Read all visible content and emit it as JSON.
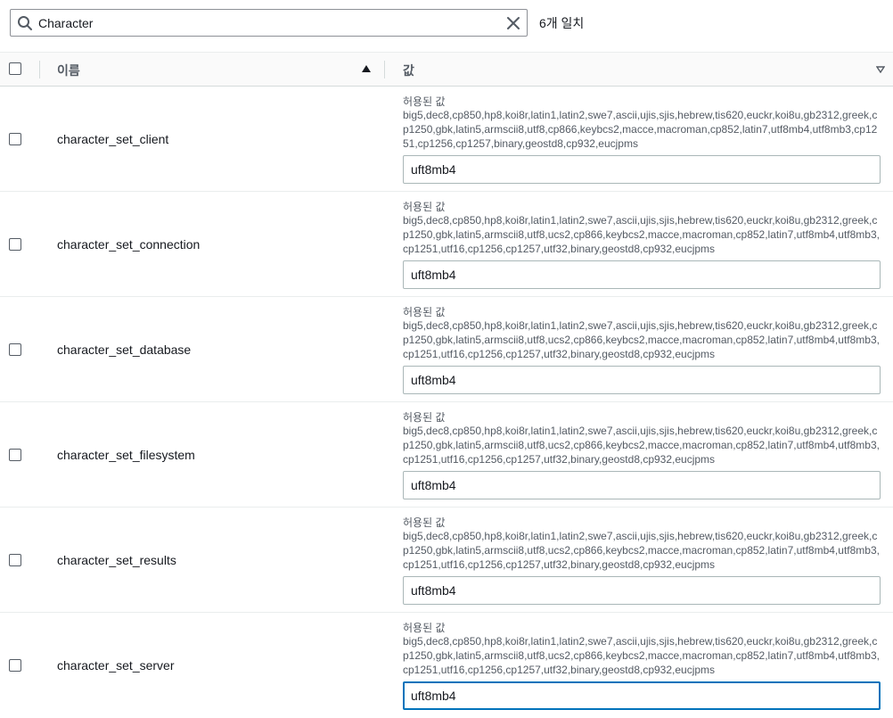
{
  "search": {
    "value": "Character",
    "match_count": "6개 일치"
  },
  "table": {
    "headers": {
      "name": "이름",
      "value": "값"
    },
    "allowed_label": "허용된 값",
    "rows": [
      {
        "name": "character_set_client",
        "allowed": "big5,dec8,cp850,hp8,koi8r,latin1,latin2,swe7,ascii,ujis,sjis,hebrew,tis620,euckr,koi8u,gb2312,greek,cp1250,gbk,latin5,armscii8,utf8,cp866,keybcs2,macce,macroman,cp852,latin7,utf8mb4,utf8mb3,cp1251,cp1256,cp1257,binary,geostd8,cp932,eucjpms",
        "value": "uft8mb4"
      },
      {
        "name": "character_set_connection",
        "allowed": "big5,dec8,cp850,hp8,koi8r,latin1,latin2,swe7,ascii,ujis,sjis,hebrew,tis620,euckr,koi8u,gb2312,greek,cp1250,gbk,latin5,armscii8,utf8,ucs2,cp866,keybcs2,macce,macroman,cp852,latin7,utf8mb4,utf8mb3,cp1251,utf16,cp1256,cp1257,utf32,binary,geostd8,cp932,eucjpms",
        "value": "uft8mb4"
      },
      {
        "name": "character_set_database",
        "allowed": "big5,dec8,cp850,hp8,koi8r,latin1,latin2,swe7,ascii,ujis,sjis,hebrew,tis620,euckr,koi8u,gb2312,greek,cp1250,gbk,latin5,armscii8,utf8,ucs2,cp866,keybcs2,macce,macroman,cp852,latin7,utf8mb4,utf8mb3,cp1251,utf16,cp1256,cp1257,utf32,binary,geostd8,cp932,eucjpms",
        "value": "uft8mb4"
      },
      {
        "name": "character_set_filesystem",
        "allowed": "big5,dec8,cp850,hp8,koi8r,latin1,latin2,swe7,ascii,ujis,sjis,hebrew,tis620,euckr,koi8u,gb2312,greek,cp1250,gbk,latin5,armscii8,utf8,ucs2,cp866,keybcs2,macce,macroman,cp852,latin7,utf8mb4,utf8mb3,cp1251,utf16,cp1256,cp1257,utf32,binary,geostd8,cp932,eucjpms",
        "value": "uft8mb4"
      },
      {
        "name": "character_set_results",
        "allowed": "big5,dec8,cp850,hp8,koi8r,latin1,latin2,swe7,ascii,ujis,sjis,hebrew,tis620,euckr,koi8u,gb2312,greek,cp1250,gbk,latin5,armscii8,utf8,ucs2,cp866,keybcs2,macce,macroman,cp852,latin7,utf8mb4,utf8mb3,cp1251,utf16,cp1256,cp1257,utf32,binary,geostd8,cp932,eucjpms",
        "value": "uft8mb4"
      },
      {
        "name": "character_set_server",
        "allowed": "big5,dec8,cp850,hp8,koi8r,latin1,latin2,swe7,ascii,ujis,sjis,hebrew,tis620,euckr,koi8u,gb2312,greek,cp1250,gbk,latin5,armscii8,utf8,ucs2,cp866,keybcs2,macce,macroman,cp852,latin7,utf8mb4,utf8mb3,cp1251,utf16,cp1256,cp1257,utf32,binary,geostd8,cp932,eucjpms",
        "value": "uft8mb4"
      }
    ]
  },
  "colors": {
    "focus": "#0073bb",
    "text": "#16191f",
    "muted": "#545b64"
  }
}
